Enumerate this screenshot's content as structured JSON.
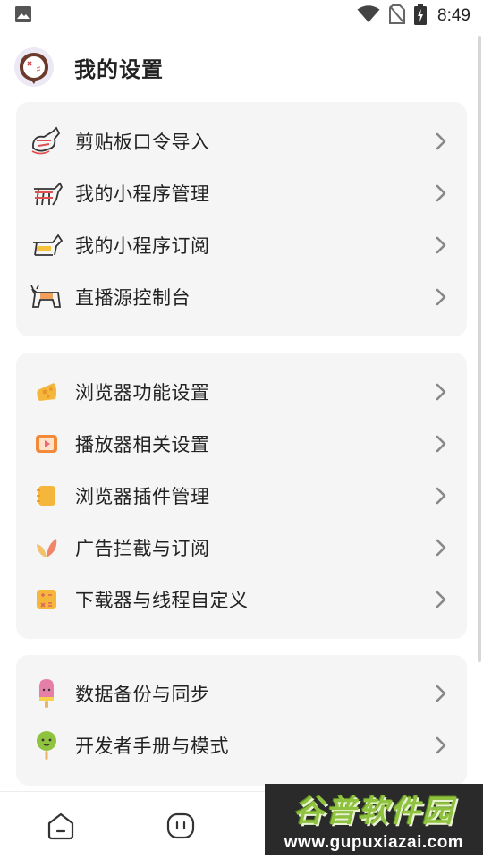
{
  "status_bar": {
    "time": "8:49",
    "icons": [
      "image-icon",
      "wifi-icon",
      "no-sim-icon",
      "battery-charging-icon"
    ]
  },
  "header": {
    "title": "我的设置",
    "avatar_icon": "cartoon-face-avatar"
  },
  "groups": [
    {
      "items": [
        {
          "label": "剪贴板口令导入",
          "icon": "doodle-animal-icon"
        },
        {
          "label": "我的小程序管理",
          "icon": "doodle-goat-icon"
        },
        {
          "label": "我的小程序订阅",
          "icon": "doodle-sheep-icon"
        },
        {
          "label": "直播源控制台",
          "icon": "doodle-cow-icon"
        }
      ]
    },
    {
      "items": [
        {
          "label": "浏览器功能设置",
          "icon": "cheese-icon"
        },
        {
          "label": "播放器相关设置",
          "icon": "video-player-icon"
        },
        {
          "label": "浏览器插件管理",
          "icon": "notebook-icon"
        },
        {
          "label": "广告拦截与订阅",
          "icon": "leaf-icon"
        },
        {
          "label": "下载器与线程自定义",
          "icon": "calculator-icon"
        }
      ]
    },
    {
      "items": [
        {
          "label": "数据备份与同步",
          "icon": "popsicle-icon"
        },
        {
          "label": "开发者手册与模式",
          "icon": "lollipop-icon"
        }
      ]
    }
  ],
  "bottom_nav": {
    "items": [
      "home-icon",
      "chat-icon",
      "bracket-icon",
      "profile-icon"
    ]
  },
  "watermark": {
    "main": "谷普软件园",
    "sub": "www.gupuxiazai.com"
  },
  "colors": {
    "card_bg": "#f5f5f5",
    "text": "#222222",
    "chevron": "#888888",
    "cheese": "#f5b73b",
    "player": "#f28a3c",
    "notebook": "#f5b73b",
    "leaf": "#f0956a",
    "calculator": "#f5b73b",
    "popsicle": "#e57fa8",
    "lollipop": "#8fc23f"
  }
}
